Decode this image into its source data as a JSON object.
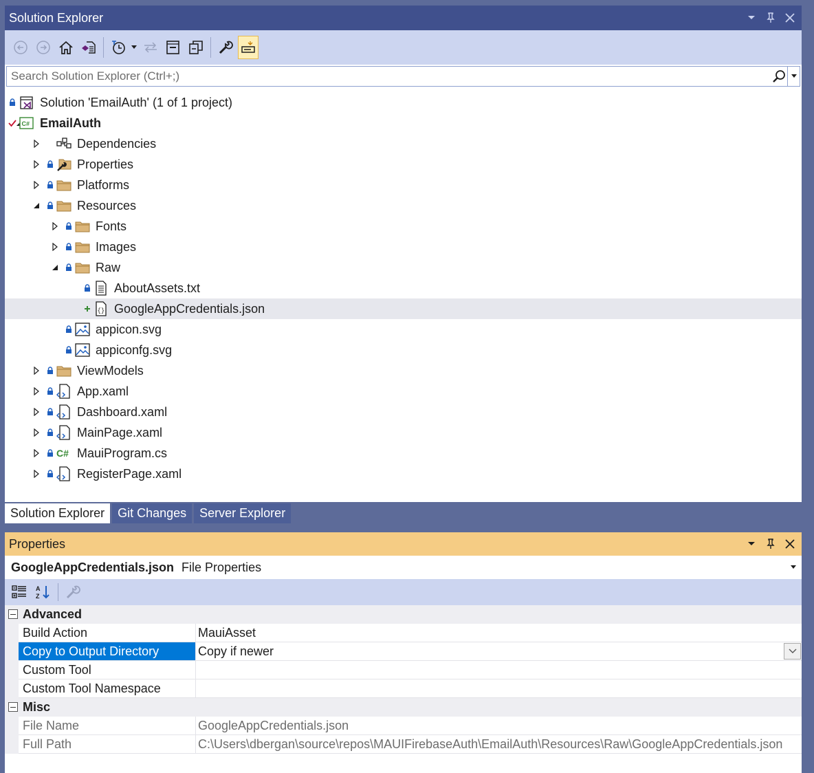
{
  "solution_explorer": {
    "title": "Solution Explorer",
    "search_placeholder": "Search Solution Explorer (Ctrl+;)",
    "tree": [
      {
        "label": "Solution 'EmailAuth' (1 of 1 project)",
        "icon": "solution-icon"
      },
      {
        "label": "EmailAuth",
        "icon": "csharp-project-icon",
        "bold": true
      },
      {
        "label": "Dependencies",
        "icon": "dependencies-icon"
      },
      {
        "label": "Properties",
        "icon": "properties-folder-icon"
      },
      {
        "label": "Platforms",
        "icon": "folder-icon"
      },
      {
        "label": "Resources",
        "icon": "folder-icon"
      },
      {
        "label": "Fonts",
        "icon": "folder-icon"
      },
      {
        "label": "Images",
        "icon": "folder-icon"
      },
      {
        "label": "Raw",
        "icon": "folder-icon"
      },
      {
        "label": "AboutAssets.txt",
        "icon": "text-file-icon"
      },
      {
        "label": "GoogleAppCredentials.json",
        "icon": "json-file-icon",
        "selected": true
      },
      {
        "label": "appicon.svg",
        "icon": "image-file-icon"
      },
      {
        "label": "appiconfg.svg",
        "icon": "image-file-icon"
      },
      {
        "label": "ViewModels",
        "icon": "folder-icon"
      },
      {
        "label": "App.xaml",
        "icon": "xaml-file-icon"
      },
      {
        "label": "Dashboard.xaml",
        "icon": "xaml-file-icon"
      },
      {
        "label": "MainPage.xaml",
        "icon": "xaml-file-icon"
      },
      {
        "label": "MauiProgram.cs",
        "icon": "csharp-file-icon"
      },
      {
        "label": "RegisterPage.xaml",
        "icon": "xaml-file-icon"
      }
    ]
  },
  "tabs": [
    {
      "label": "Solution Explorer",
      "active": true
    },
    {
      "label": "Git Changes",
      "active": false
    },
    {
      "label": "Server Explorer",
      "active": false
    }
  ],
  "properties": {
    "title": "Properties",
    "object_name": "GoogleAppCredentials.json",
    "object_type": "File Properties",
    "categories": [
      {
        "name": "Advanced",
        "rows": [
          {
            "name": "Build Action",
            "value": "MauiAsset"
          },
          {
            "name": "Copy to Output Directory",
            "value": "Copy if newer",
            "selected": true
          },
          {
            "name": "Custom Tool",
            "value": ""
          },
          {
            "name": "Custom Tool Namespace",
            "value": ""
          }
        ]
      },
      {
        "name": "Misc",
        "rows": [
          {
            "name": "File Name",
            "value": "GoogleAppCredentials.json",
            "readonly": true
          },
          {
            "name": "Full Path",
            "value": "C:\\Users\\dbergan\\source\\repos\\MAUIFirebaseAuth\\EmailAuth\\Resources\\Raw\\GoogleAppCredentials.json",
            "readonly": true
          }
        ]
      }
    ]
  },
  "colors": {
    "frame": "#5d6b99",
    "title_bar": "#40508d",
    "toolbar": "#ccd5f0",
    "properties_title": "#f5cc84",
    "selection_blue": "#0078d7",
    "lock_blue": "#1f5fbf"
  }
}
